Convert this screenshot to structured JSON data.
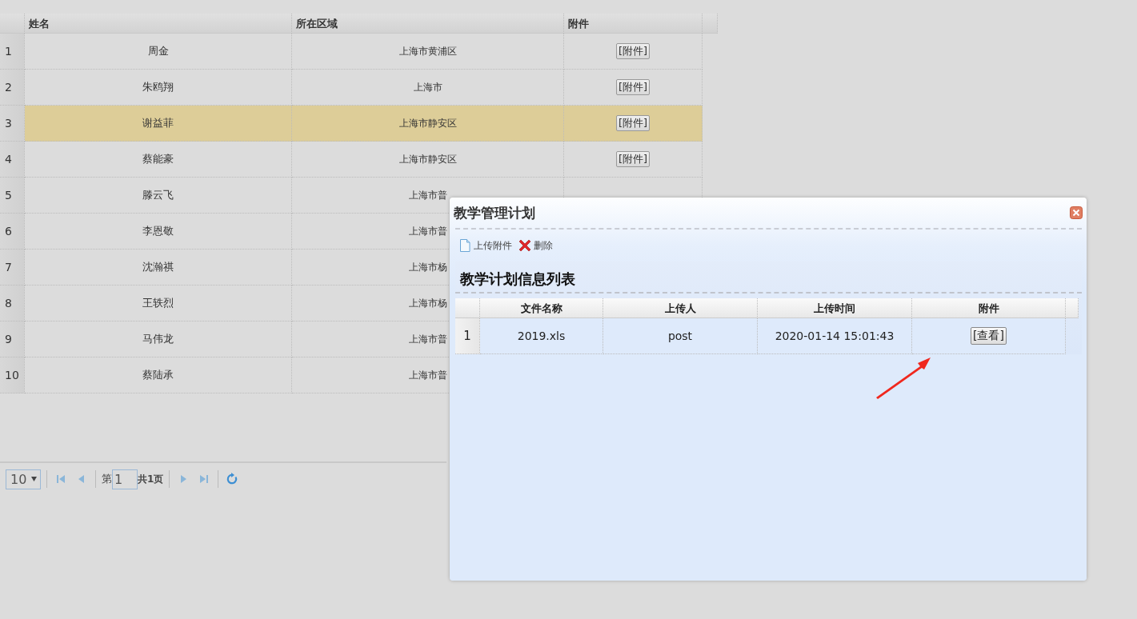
{
  "grid": {
    "columns": [
      {
        "label": "姓名"
      },
      {
        "label": "所在区域"
      },
      {
        "label": "附件"
      }
    ],
    "rows": [
      {
        "index": "1",
        "name": "周金",
        "region": "上海市黄浦区",
        "attachment": "[附件]",
        "selected": false
      },
      {
        "index": "2",
        "name": "朱鸥翔",
        "region": "上海市",
        "attachment": "[附件]",
        "selected": false
      },
      {
        "index": "3",
        "name": "谢益菲",
        "region": "上海市静安区",
        "attachment": "[附件]",
        "selected": true
      },
      {
        "index": "4",
        "name": "蔡能豪",
        "region": "上海市静安区",
        "attachment": "[附件]",
        "selected": false
      },
      {
        "index": "5",
        "name": "滕云飞",
        "region": "上海市普",
        "selected": false
      },
      {
        "index": "6",
        "name": "李恩敬",
        "region": "上海市普",
        "selected": false
      },
      {
        "index": "7",
        "name": "沈瀚祺",
        "region": "上海市杨",
        "selected": false
      },
      {
        "index": "8",
        "name": "王轶烈",
        "region": "上海市杨",
        "selected": false
      },
      {
        "index": "9",
        "name": "马伟龙",
        "region": "上海市普",
        "selected": false
      },
      {
        "index": "10",
        "name": "蔡陆承",
        "region": "上海市普",
        "selected": false
      }
    ]
  },
  "pager": {
    "page_size": "10",
    "page_prefix": "第",
    "page": "1",
    "total": "共1页"
  },
  "dialog": {
    "title": "教学管理计划",
    "toolbar": [
      {
        "kind": "upload",
        "label": "上传附件"
      },
      {
        "kind": "delete",
        "label": "删除"
      }
    ],
    "panel_title": "教学计划信息列表",
    "columns": [
      {
        "label": "文件名称"
      },
      {
        "label": "上传人"
      },
      {
        "label": "上传时间"
      },
      {
        "label": "附件"
      }
    ],
    "rows": [
      {
        "index": "1",
        "cells": [
          "2019.xls",
          "post",
          "2020-01-14 15:01:43"
        ],
        "action": "[查看]"
      }
    ]
  }
}
